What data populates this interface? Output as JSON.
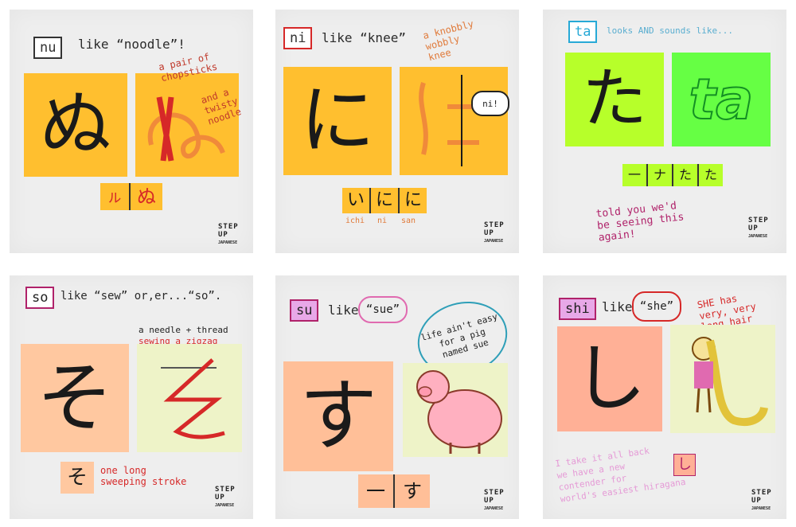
{
  "logo": {
    "line1": "STEP",
    "line2": "UP",
    "line3": "JAPANESE"
  },
  "cards": {
    "nu": {
      "tag": "nu",
      "like": "like “noodle”!",
      "kana": "ぬ",
      "latin": "ぬ",
      "note1": "a pair of",
      "note2": "chopsticks",
      "note3": "and a",
      "note4": "twisty",
      "note5": "noodle",
      "strip": [
        "ㇽ",
        "ぬ"
      ]
    },
    "ni": {
      "tag": "ni",
      "like": "like “knee”",
      "kana": "に",
      "bubble": "ni!",
      "note1": "a knobbly",
      "note2": "wobbly",
      "note3": "knee",
      "strip": [
        "い",
        "に",
        "に"
      ],
      "labels": [
        "ichi",
        "ni",
        "san"
      ]
    },
    "ta": {
      "tag": "ta",
      "like": "looks AND sounds like...",
      "kana": "た",
      "latin": "ta",
      "strip": [
        "一",
        "ナ",
        "た",
        "た"
      ],
      "note1": "told you we'd",
      "note2": "be seeing this",
      "note3": "again!"
    },
    "so": {
      "tag": "so",
      "like": "like “sew” or,er...“so”.",
      "kana": "そ",
      "note1": "a needle + thread",
      "note2": "sewing a zigzag",
      "strip": [
        "そ"
      ],
      "stroke1": "one long",
      "stroke2": "sweeping stroke"
    },
    "su": {
      "tag": "su",
      "like": "like",
      "sound": "“sue”",
      "kana": "す",
      "bubble1": "life ain't easy",
      "bubble2": "for a pig",
      "bubble3": "named sue",
      "strip": [
        "一",
        "す"
      ]
    },
    "shi": {
      "tag": "shi",
      "like": "like",
      "sound": "“she”",
      "kana": "し",
      "note1": "SHE has",
      "note2": "very, very",
      "note3": "long hair",
      "back1": "I take it all back",
      "back2": "we have a new",
      "back3": "contender for",
      "back4": "world's easiest hiragana",
      "mini": "し"
    }
  }
}
